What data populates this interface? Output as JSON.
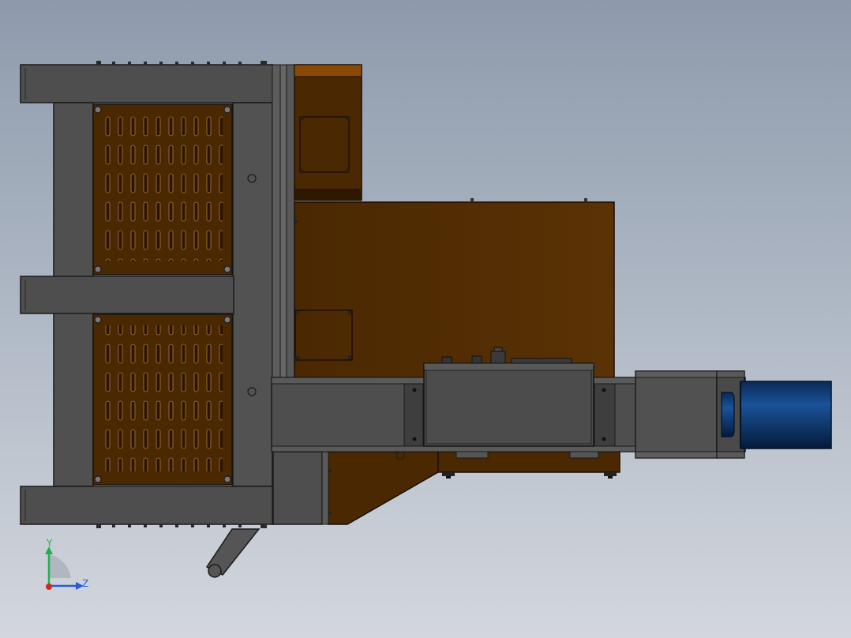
{
  "viewport": {
    "background_top": "#8e9aac",
    "background_bottom": "#d3d7dd"
  },
  "colors": {
    "frame_steel": "#4e4e4e",
    "frame_edge": "#1c1c1c",
    "panel_brown": "#4a2802",
    "panel_accent": "#8a4a06",
    "motor_blue": "#0d3a6e",
    "triad_y": "#22b14c",
    "triad_z": "#2a5bd7",
    "triad_x": "#d62424"
  },
  "triad": {
    "y_label": "Y",
    "z_label": "Z"
  }
}
